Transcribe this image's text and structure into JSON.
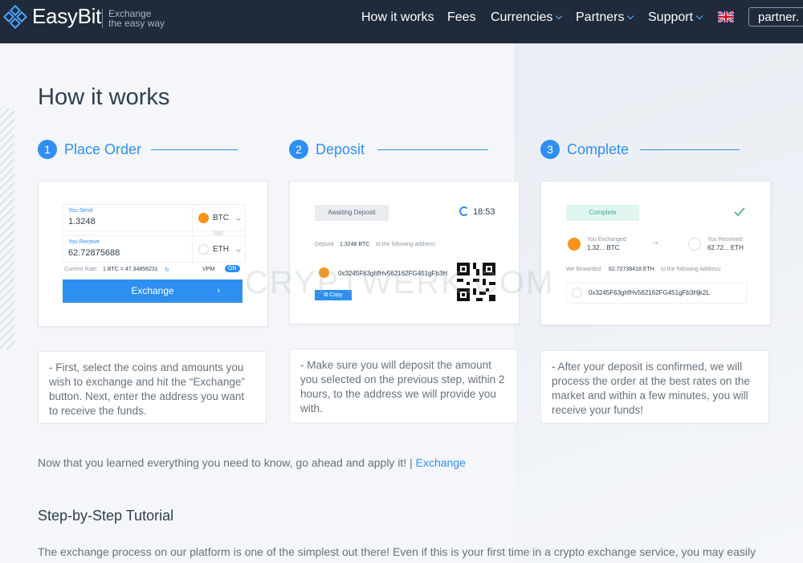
{
  "header": {
    "brand": "EasyBit",
    "tagline_1": "Exchange",
    "tagline_2": "the easy way",
    "nav": [
      {
        "label": "How it works"
      },
      {
        "label": "Fees"
      },
      {
        "label": "Currencies"
      },
      {
        "label": "Partners"
      },
      {
        "label": "Support"
      }
    ],
    "partner_label": "partner."
  },
  "page": {
    "title": "How it works",
    "watermark": "CRYPTWERK.COM"
  },
  "steps": [
    {
      "num": "1",
      "title": "Place Order",
      "desc": "- First, select the coins and amounts you wish to exchange and hit the “Exchange” button. Next, enter the address you want to receive the funds."
    },
    {
      "num": "2",
      "title": "Deposit",
      "desc": "- Make sure you will deposit the amount you selected on the previous step, within 2 hours, to the address we will provide you with."
    },
    {
      "num": "3",
      "title": "Complete",
      "desc": "- After your deposit is confirmed, we will process the order at the best rates on the market and within a few minutes, you will receive your funds!"
    }
  ],
  "card1": {
    "send_label": "You Send",
    "send_value": "1.3248",
    "send_coin": "BTC",
    "receive_label": "You Receive",
    "receive_value": "62.72875688",
    "receive_coin": "ETH",
    "rate_label": "Current Rate:",
    "rate_value": "1 BTC = 47.34856231",
    "vpm": "VPM",
    "toggle": "ON",
    "exchange_label": "Exchange"
  },
  "card2": {
    "status": "Awaiting Deposit",
    "timer": "18:53",
    "deposit_prefix": "Deposit",
    "deposit_amount": "1.3248 BTC",
    "deposit_suffix": "to the following address:",
    "address": "0x3245F63ghfHv562162FG451gFb3H",
    "copy_label": "Copy"
  },
  "card3": {
    "status": "Complete",
    "exchanged_label": "You Exchanged",
    "exchanged_value": "1.32... BTC",
    "received_label": "You Received:",
    "received_value": "62.72... ETH",
    "forward_prefix": "We forwarded",
    "forward_amount": "62.72738418 ETH",
    "forward_suffix": "to the following Address:",
    "address": "0x3245F63ghfHv562162FG451gFb3Hjk2L"
  },
  "cta": {
    "text": "Now that you learned everything you need to know, go ahead and apply it! |",
    "link": "Exchange"
  },
  "tutorial": {
    "heading": "Step-by-Step Tutorial",
    "paragraph": "The exchange process on our platform is one of the simplest out there! Even if this is your first time in a crypto exchange service, you may easily"
  },
  "colors": {
    "header_bg": "#1f2a3a",
    "accent": "#2e8ff0",
    "page_bg": "#f4f6f9",
    "bitcoin": "#f7931a",
    "success": "#3ea993"
  }
}
